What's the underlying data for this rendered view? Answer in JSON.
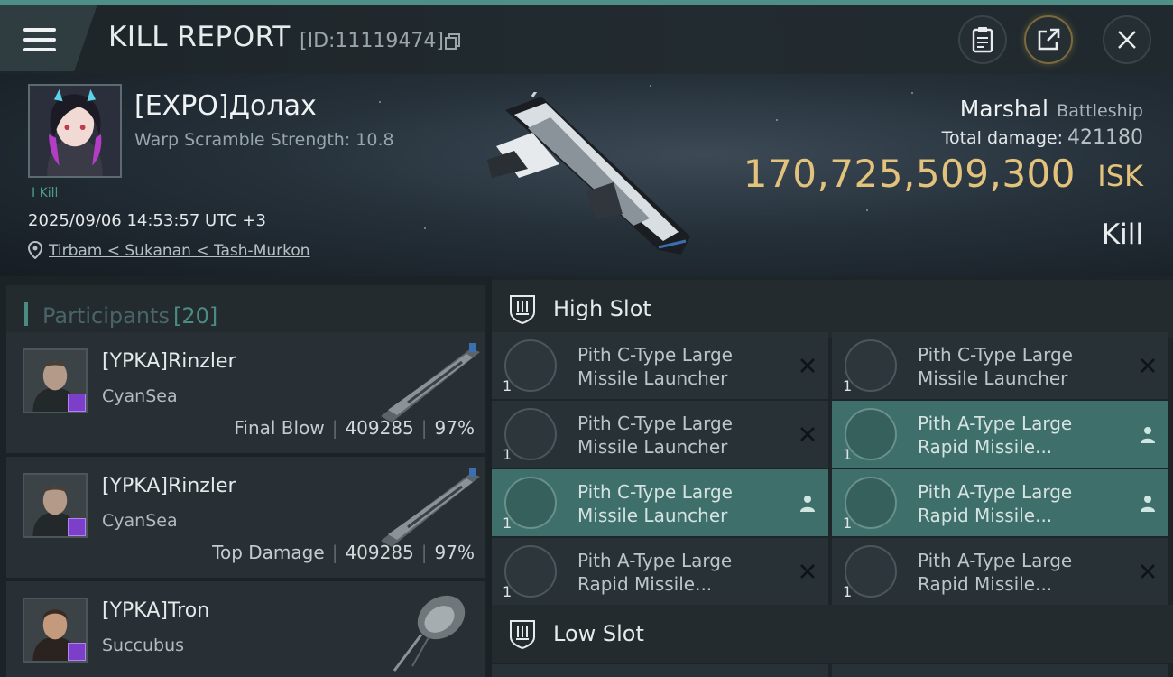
{
  "header": {
    "title": "KILL REPORT",
    "id_text": "[ID:11119474]",
    "icons": [
      "menu-icon",
      "copy-icon",
      "clipboard-icon",
      "share-icon",
      "close-icon"
    ]
  },
  "victim": {
    "name": "[EXPO]Долах",
    "warp_scramble": "Warp Scramble Strength: 10.8",
    "kills_label": "I Kill",
    "timestamp": "2025/09/06 14:53:57 UTC +3",
    "location": "Tirbam < Sukanan < Tash-Murkon",
    "ship_name": "Marshal",
    "ship_class": "Battleship",
    "total_damage_label": "Total damage:",
    "total_damage": "421180",
    "isk_value": "170,725,509,300",
    "isk_unit": "ISK",
    "result": "Kill"
  },
  "participants": {
    "title": "Participants",
    "count": "[20]",
    "rows": [
      {
        "name": "[YPKA]Rinzler",
        "ship": "CyanSea",
        "label": "Final Blow",
        "damage": "409285",
        "percent": "97%"
      },
      {
        "name": "[YPKA]Rinzler",
        "ship": "CyanSea",
        "label": "Top Damage",
        "damage": "409285",
        "percent": "97%"
      },
      {
        "name": "[YPKA]Tron",
        "ship": "Succubus",
        "label": "",
        "damage": "",
        "percent": ""
      }
    ]
  },
  "slots": {
    "high_label": "High Slot",
    "low_label": "Low Slot",
    "modules": [
      {
        "line1": "Pith C-Type Large",
        "line2": "Missile Launcher",
        "qty": "1",
        "status": "destroyed"
      },
      {
        "line1": "Pith C-Type Large",
        "line2": "Missile Launcher",
        "qty": "1",
        "status": "destroyed"
      },
      {
        "line1": "Pith C-Type Large",
        "line2": "Missile Launcher",
        "qty": "1",
        "status": "destroyed"
      },
      {
        "line1": "Pith A-Type Large",
        "line2": "Rapid Missile...",
        "qty": "1",
        "status": "dropped"
      },
      {
        "line1": "Pith C-Type Large",
        "line2": "Missile Launcher",
        "qty": "1",
        "status": "dropped"
      },
      {
        "line1": "Pith A-Type Large",
        "line2": "Rapid Missile...",
        "qty": "1",
        "status": "dropped"
      },
      {
        "line1": "Pith A-Type Large",
        "line2": "Rapid Missile...",
        "qty": "1",
        "status": "destroyed"
      },
      {
        "line1": "Pith A-Type Large",
        "line2": "Rapid Missile...",
        "qty": "1",
        "status": "destroyed"
      }
    ]
  },
  "colors": {
    "accent_teal": "#4e8f88",
    "isk_gold": "#e3c27c",
    "highlight_row": "#3f6f6b"
  }
}
